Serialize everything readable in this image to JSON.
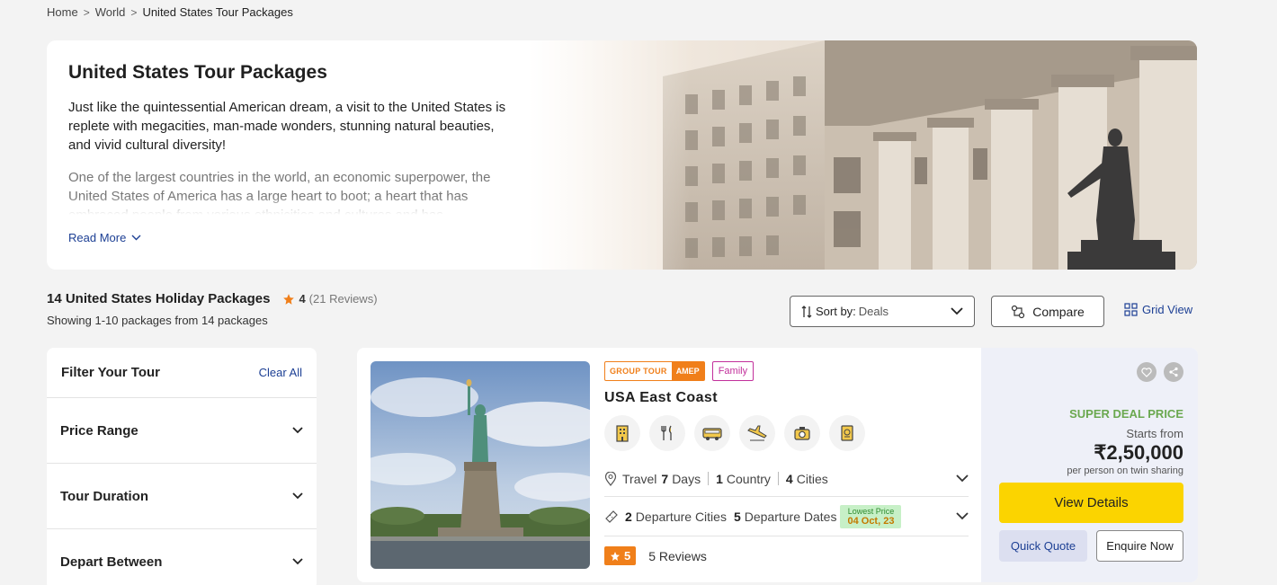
{
  "breadcrumb": {
    "home": "Home",
    "world": "World",
    "current": "United States Tour Packages",
    "separator": ">"
  },
  "hero": {
    "title": "United States Tour Packages",
    "paragraph1": "Just like the quintessential American dream, a visit to the United States is replete with megacities, man-made wonders, stunning natural beauties, and vivid cultural diversity!",
    "paragraph2": "One of the largest countries in the world, an economic superpower, the United States of America has a large heart to boot; a heart that has embraced people from various ethnicities and cultures and has",
    "read_more": "Read More"
  },
  "summary": {
    "title": "14 United States Holiday Packages",
    "rating": "4",
    "reviews": "(21 Reviews)",
    "showing": "Showing 1-10 packages from 14 packages"
  },
  "toolbar": {
    "sort_label": "Sort by:",
    "sort_value": "Deals",
    "compare": "Compare",
    "grid_view": "Grid View"
  },
  "filters": {
    "title": "Filter Your Tour",
    "clear_all": "Clear All",
    "items": [
      {
        "label": "Price Range"
      },
      {
        "label": "Tour Duration"
      },
      {
        "label": "Depart Between"
      }
    ]
  },
  "package": {
    "tag_group": "GROUP TOUR",
    "tag_code": "AMEP",
    "tag_type": "Family",
    "name": "USA East Coast",
    "inclusions": [
      "hotel-icon",
      "meals-icon",
      "bus-icon",
      "flight-icon",
      "sightseeing-icon",
      "visa-icon"
    ],
    "travel_label": "Travel",
    "days": "7",
    "days_label": "Days",
    "countries": "1",
    "countries_label": "Country",
    "cities": "4",
    "cities_label": "Cities",
    "departure_cities": "2",
    "departure_cities_label": "Departure Cities",
    "departure_dates": "5",
    "departure_dates_label": "Departure Dates",
    "lowest_price_label": "Lowest Price",
    "lowest_price_date": "04 Oct, 23",
    "rating": "5",
    "reviews": "5 Reviews",
    "deal_label": "SUPER DEAL PRICE",
    "starts_from": "Starts from",
    "price": "₹2,50,000",
    "price_note": "per person on twin sharing",
    "view_details": "View Details",
    "quick_quote": "Quick Quote",
    "enquire_now": "Enquire Now"
  },
  "colors": {
    "accent_blue": "#1c3f94",
    "orange": "#f07f1a",
    "yellow_button": "#fbd400",
    "deal_green": "#6aa84f",
    "family_pink": "#c2309b"
  }
}
